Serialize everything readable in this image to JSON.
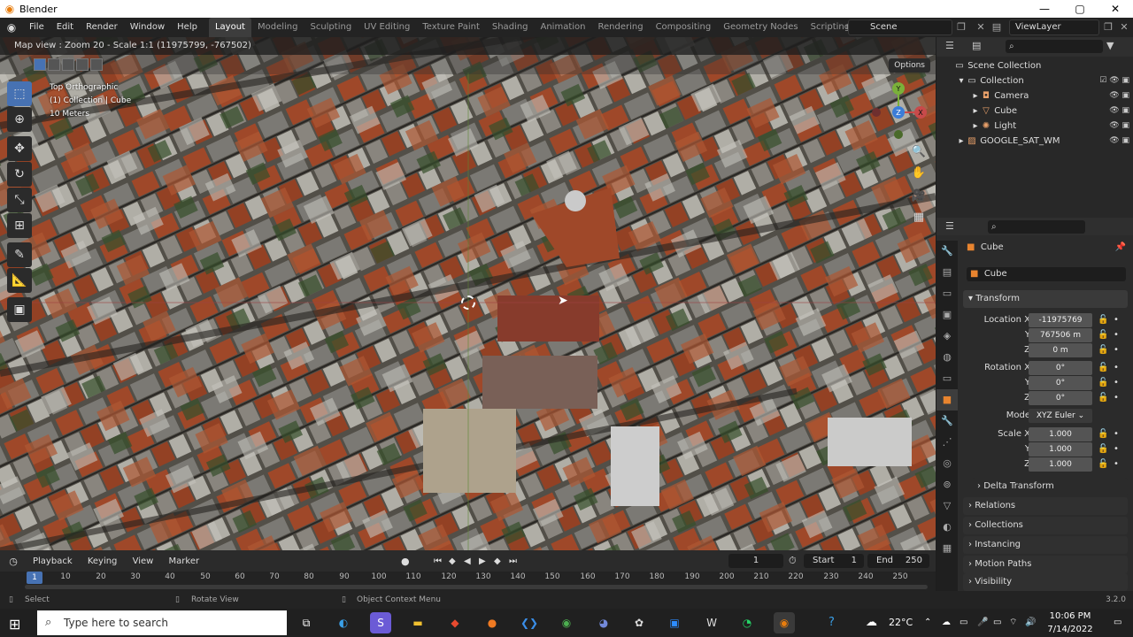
{
  "window": {
    "title": "Blender",
    "min": "—",
    "max": "▢",
    "close": "✕"
  },
  "menus": [
    "File",
    "Edit",
    "Render",
    "Window",
    "Help"
  ],
  "workspaces": [
    "Layout",
    "Modeling",
    "Sculpting",
    "UV Editing",
    "Texture Paint",
    "Shading",
    "Animation",
    "Rendering",
    "Compositing",
    "Geometry Nodes",
    "Scripting"
  ],
  "active_workspace": "Layout",
  "workspace_add": "+",
  "scene": "Scene",
  "view_layer": "ViewLayer",
  "viewport": {
    "header_text": "Map view : Zoom 20 - Scale 1:1 (11975799, -767502)",
    "options_label": "Options",
    "overlay_lines": [
      "Top Orthographic",
      "(1) Collection | Cube",
      "10 Meters"
    ],
    "gizmo_labels": {
      "y": "Y",
      "z": "Z",
      "x": "X"
    }
  },
  "timeline": {
    "menus": [
      "Playback",
      "Keying",
      "View",
      "Marker"
    ],
    "current_frame": "1",
    "start_label": "Start",
    "start_value": "1",
    "end_label": "End",
    "end_value": "250",
    "ticks": [
      "10",
      "20",
      "30",
      "40",
      "50",
      "60",
      "70",
      "80",
      "90",
      "100",
      "110",
      "120",
      "130",
      "140",
      "150",
      "160",
      "170",
      "180",
      "190",
      "200",
      "210",
      "220",
      "230",
      "240",
      "250"
    ],
    "playhead": "1"
  },
  "statusbar": {
    "select": "Select",
    "rotate": "Rotate View",
    "context": "Object Context Menu",
    "version": "3.2.0"
  },
  "outliner": {
    "root": "Scene Collection",
    "items": [
      {
        "name": "Collection",
        "indent": 1
      },
      {
        "name": "Camera",
        "indent": 2
      },
      {
        "name": "Cube",
        "indent": 2
      },
      {
        "name": "Light",
        "indent": 2
      },
      {
        "name": "GOOGLE_SAT_WM",
        "indent": 1
      }
    ]
  },
  "properties": {
    "object_name": "Cube",
    "mesh_name": "Cube",
    "transform_label": "Transform",
    "location": {
      "label": "Location X",
      "x": "-11975769",
      "y": "767506 m",
      "z": "0 m"
    },
    "rotation": {
      "label": "Rotation X",
      "x": "0°",
      "y": "0°",
      "z": "0°"
    },
    "mode_label": "Mode",
    "mode_value": "XYZ Euler",
    "scale": {
      "label": "Scale X",
      "x": "1.000",
      "y": "1.000",
      "z": "1.000"
    },
    "axis_y": "Y",
    "axis_z": "Z",
    "panels": [
      "Delta Transform",
      "Relations",
      "Collections",
      "Instancing",
      "Motion Paths",
      "Visibility"
    ]
  },
  "taskbar": {
    "search_placeholder": "Type here to search",
    "temperature": "22°C",
    "time": "10:06 PM",
    "date": "7/14/2022"
  },
  "colors": {
    "accent": "#4772b3",
    "blender_orange": "#e87d0d",
    "active_tab": "#3d3d3d"
  }
}
